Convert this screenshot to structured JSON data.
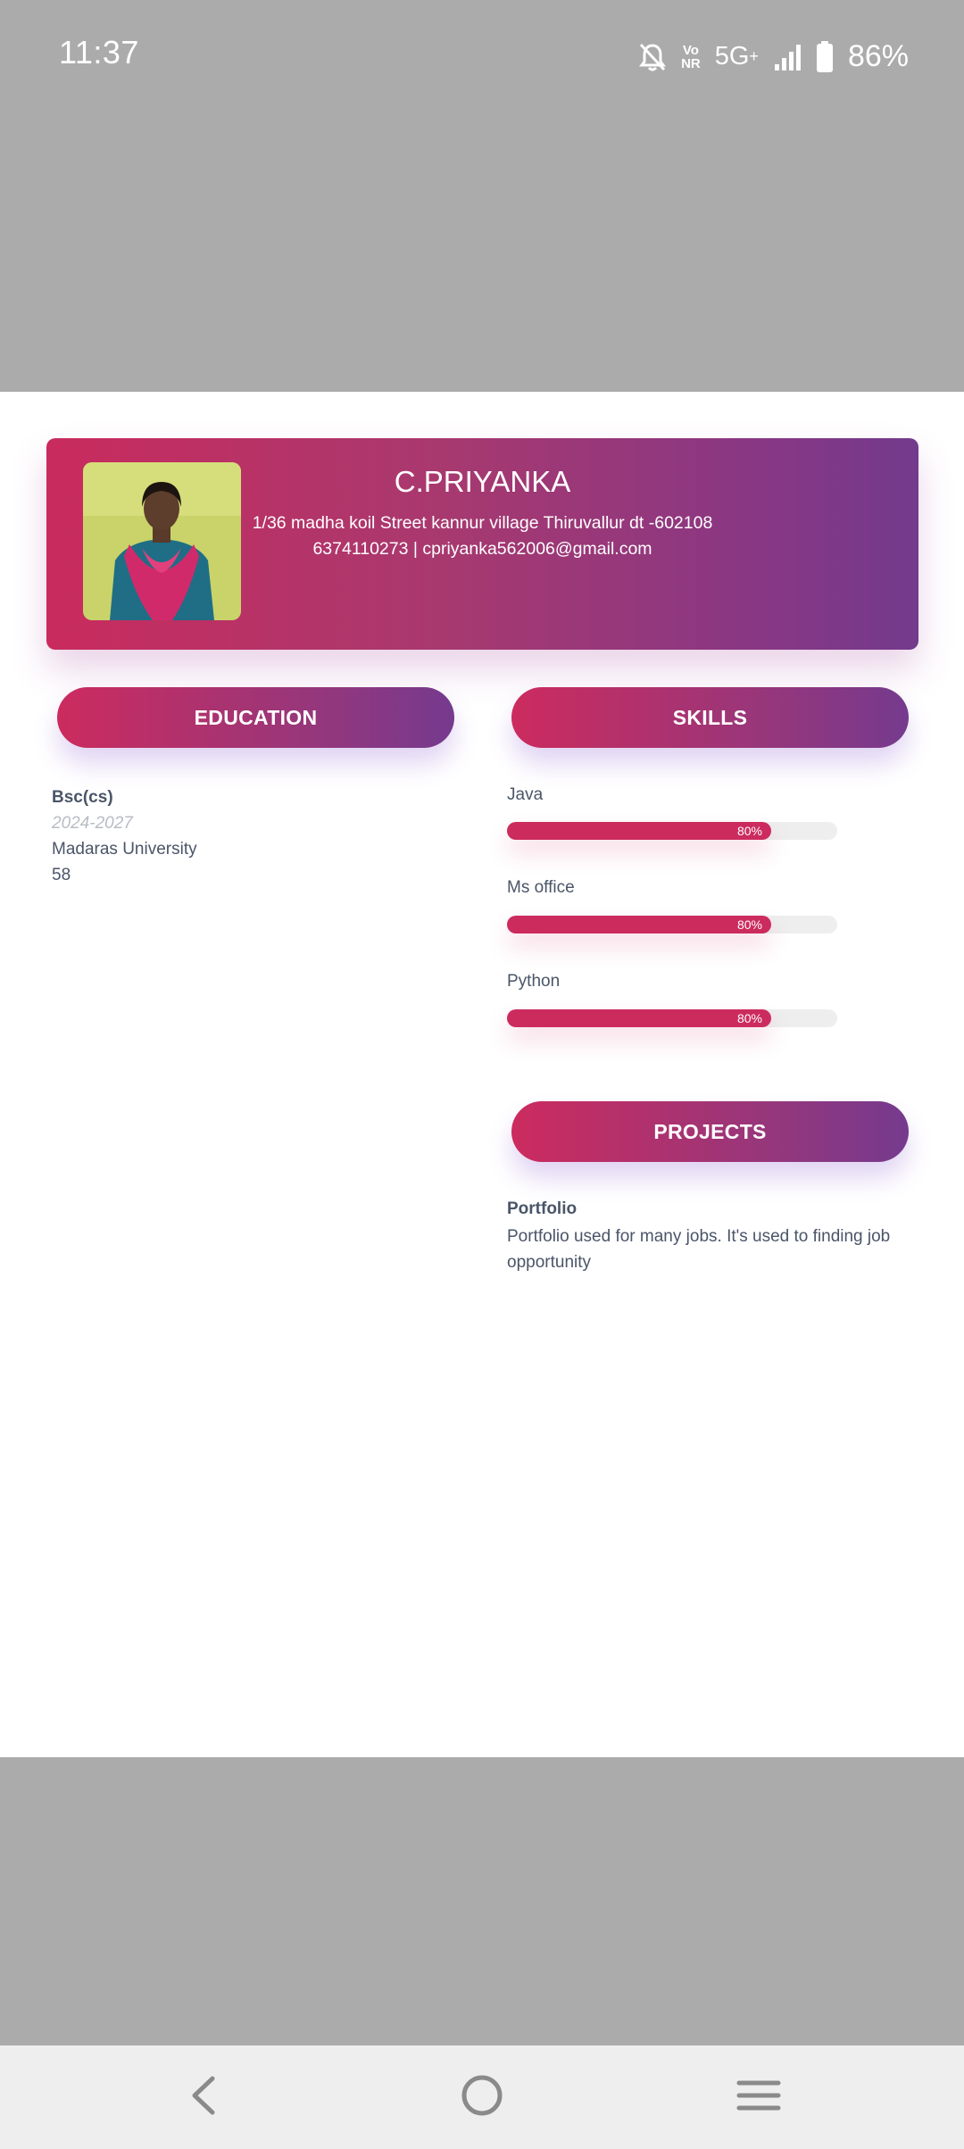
{
  "status_bar": {
    "time": "11:37",
    "icons": [
      "bell-muted-icon",
      "volte-icon",
      "network-5g-icon",
      "signal-icon",
      "battery-icon"
    ],
    "volte_line1": "Vo",
    "volte_line2": "NR",
    "network": "5G",
    "network_plus": "+",
    "battery_percent": "86%"
  },
  "header": {
    "name": "C.PRIYANKA",
    "address": "1/36 madha koil Street kannur village Thiruvallur dt -602108",
    "contact": "6374110273 | cpriyanka562006@gmail.com",
    "photo": "profile-photo"
  },
  "sections": {
    "education": "EDUCATION",
    "skills": "SKILLS",
    "projects": "PROJECTS"
  },
  "education": {
    "degree": "Bsc(cs)",
    "years": "2024-2027",
    "university": "Madaras University",
    "score": "58"
  },
  "skills": [
    {
      "name": "Java",
      "level": 0.8,
      "label": "80%"
    },
    {
      "name": "Ms office",
      "level": 0.8,
      "label": "80%"
    },
    {
      "name": "Python",
      "level": 0.8,
      "label": "80%"
    }
  ],
  "projects": [
    {
      "title": "Portfolio",
      "description": "Portfolio used for many jobs. It's used to finding job opportunity"
    }
  ],
  "nav_bar": {
    "buttons": [
      "back-icon",
      "home-icon",
      "recents-menu-icon"
    ]
  },
  "colors": {
    "accent_start": "#cc2b5e",
    "accent_end": "#753a8e",
    "backdrop": "#ababab",
    "nav_background": "#eeeeee"
  }
}
